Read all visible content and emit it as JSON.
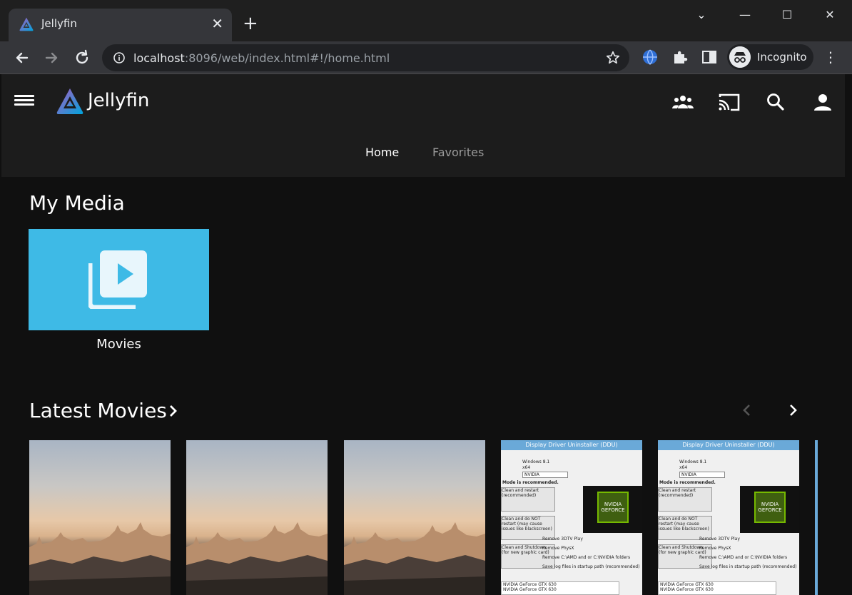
{
  "browser": {
    "tab_title": "Jellyfin",
    "tab_close": "✕",
    "new_tab": "+",
    "url_host": "localhost",
    "url_rest": ":8096/web/index.html#!/home.html",
    "profile_label": "Incognito",
    "menu": "⋮",
    "window_controls": [
      "⌄",
      "—",
      "☐",
      "✕"
    ]
  },
  "app": {
    "brand": "Jellyfin",
    "accent": "#3ebae6",
    "tabs": [
      {
        "label": "Home",
        "active": true
      },
      {
        "label": "Favorites",
        "active": false
      }
    ]
  },
  "my_media": {
    "title": "My Media",
    "items": [
      {
        "label": "Movies",
        "icon": "video-library-icon"
      }
    ]
  },
  "latest_movies": {
    "title": "Latest Movies",
    "posters": [
      {
        "kind": "city"
      },
      {
        "kind": "city"
      },
      {
        "kind": "city"
      },
      {
        "kind": "ddu",
        "window_title": "Display Driver Uninstaller (DDU)",
        "version": "Windows 8.1",
        "arch": "x64",
        "vendor": "NVIDIA",
        "mode_note": "Mode is recommended.",
        "options": [
          "Remove 3DTV Play",
          "Remove PhysX",
          "Remove C:\\AMD and or C:\\NVIDIA folders",
          "Save log files in startup path (recommended)"
        ],
        "buttons": [
          "Clean and restart (recommended)",
          "Clean and do NOT restart (may cause issues like blackscreen)",
          "Clean and Shutdown (for new graphic card)"
        ],
        "logo_text": [
          "NVIDIA",
          "GEFORCE"
        ],
        "footer": [
          "NVIDIA GeForce GTX 630",
          "NVIDIA GeForce GTX 630"
        ]
      },
      {
        "kind": "ddu",
        "window_title": "Display Driver Uninstaller (DDU)",
        "version": "Windows 8.1",
        "arch": "x64",
        "vendor": "NVIDIA",
        "mode_note": "Mode is recommended.",
        "options": [
          "Remove 3DTV Play",
          "Remove PhysX",
          "Remove C:\\AMD and or C:\\NVIDIA folders",
          "Save log files in startup path (recommended)"
        ],
        "buttons": [
          "Clean and restart (recommended)",
          "Clean and do NOT restart (may cause issues like blackscreen)",
          "Clean and Shutdown (for new graphic card)"
        ],
        "logo_text": [
          "NVIDIA",
          "GEFORCE"
        ],
        "footer": [
          "NVIDIA GeForce GTX 630",
          "NVIDIA GeForce GTX 630"
        ]
      }
    ]
  }
}
